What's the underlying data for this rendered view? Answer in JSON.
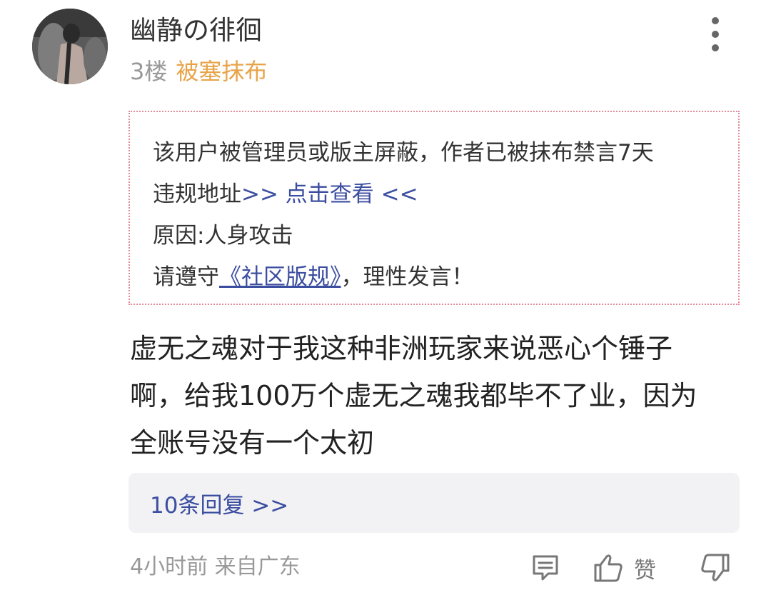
{
  "post": {
    "username": "幽静の徘徊",
    "floor": "3楼",
    "badge": "被塞抹布"
  },
  "notice": {
    "line1": "该用户被管理员或版主屏蔽，作者已被抹布禁言7天",
    "line2_prefix": "违规地址",
    "line2_link": ">> 点击查看 <<",
    "line3": "原因:人身攻击",
    "line4_prefix": "请遵守",
    "line4_link": "《社区版规》",
    "line4_suffix": "，理性发言！"
  },
  "content": {
    "lines": [
      "虚无之魂对于我这种非洲玩家来说恶心个锤子",
      "啊，给我100万个虚无之魂我都毕不了业，因为",
      "全账号没有一个太初"
    ]
  },
  "replies": {
    "label": "10条回复 >>"
  },
  "footer": {
    "time_location": "4小时前 来自广东",
    "like_label": "赞"
  },
  "icons": {
    "more": "more-vertical-icon",
    "comment": "comment-icon",
    "like": "thumbs-up-icon",
    "dislike": "thumbs-down-icon"
  },
  "colors": {
    "badge": "#e8a44a",
    "link": "#3c4ea0",
    "notice_border": "#e08a9a",
    "replies_bg": "#f2f2f4",
    "muted": "#999999"
  }
}
